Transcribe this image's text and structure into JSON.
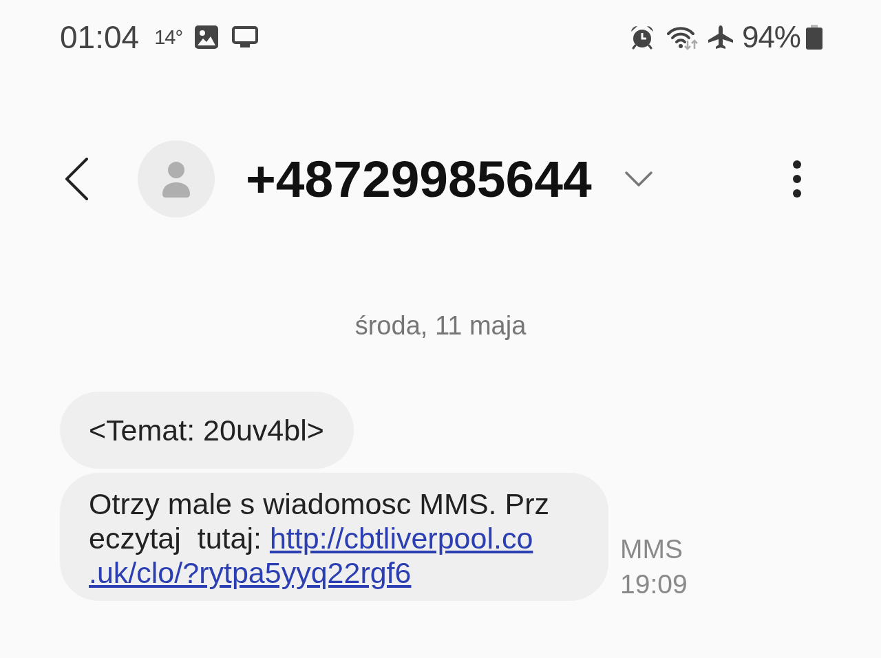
{
  "status_bar": {
    "time": "01:04",
    "temperature": "14°",
    "battery": "94%"
  },
  "header": {
    "contact": "+48729985644"
  },
  "conversation": {
    "date": "środa, 11 maja",
    "messages": [
      {
        "lines": [
          {
            "text": "<Temat: 20uv4bl>"
          }
        ]
      },
      {
        "lines": [
          {
            "text": "Otrzy male s wiadomosc MMS. Prz"
          },
          {
            "text": "eczytaj  tutaj: ",
            "link": "http://cbtliverpool.co"
          },
          {
            "link": ".uk/clo/?rytpa5yyq22rgf6"
          }
        ],
        "type_label": "MMS",
        "time": "19:09"
      }
    ]
  }
}
